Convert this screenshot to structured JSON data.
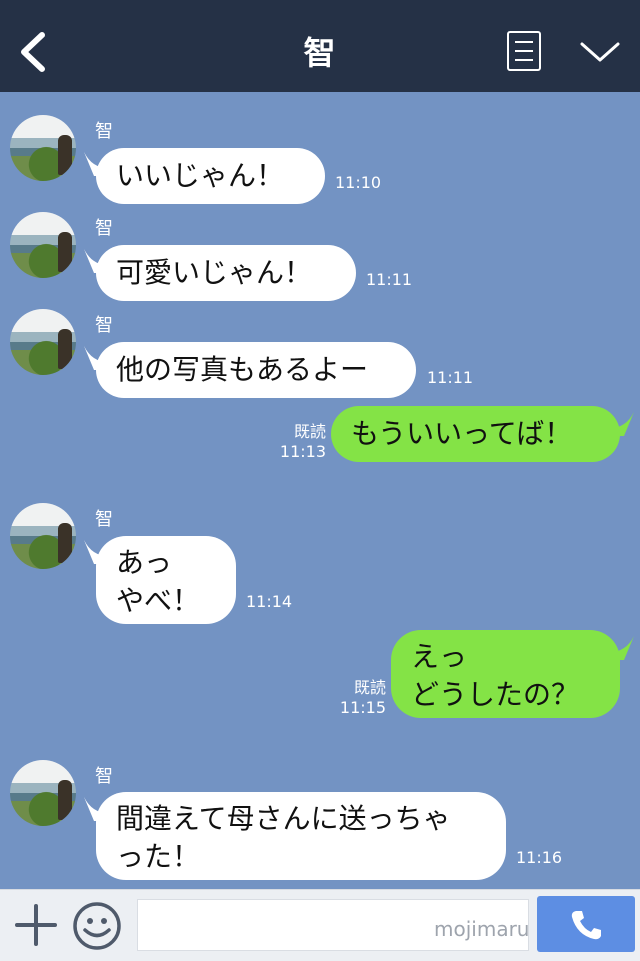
{
  "header": {
    "title": "智"
  },
  "messages": [
    {
      "id": 1,
      "side": "left",
      "sender": "智",
      "text": "いいじゃん！",
      "time": "11:10"
    },
    {
      "id": 2,
      "side": "left",
      "sender": "智",
      "text": "可愛いじゃん！",
      "time": "11:11"
    },
    {
      "id": 3,
      "side": "left",
      "sender": "智",
      "text": "他の写真もあるよー",
      "time": "11:11"
    },
    {
      "id": 4,
      "side": "right",
      "read": "既読",
      "text": "もういいってば！",
      "time": "11:13"
    },
    {
      "id": 5,
      "side": "left",
      "sender": "智",
      "text": "あっ\nやべ！",
      "time": "11:14"
    },
    {
      "id": 6,
      "side": "right",
      "read": "既読",
      "text": "えっ\nどうしたの？",
      "time": "11:15"
    },
    {
      "id": 7,
      "side": "left",
      "sender": "智",
      "text": "間違えて母さんに送っちゃ\nった！",
      "time": "11:16"
    }
  ],
  "footer": {
    "input_value": "",
    "watermark": "mojimaru"
  },
  "colors": {
    "header_bg": "#253146",
    "chat_bg": "#7393c3",
    "bubble_left": "#ffffff",
    "bubble_right": "#84e346",
    "call_button": "#5d8ee3"
  },
  "icons": {
    "back": "chevron-left-icon",
    "menu": "menu-list-icon",
    "collapse": "chevron-down-icon",
    "add": "plus-icon",
    "emoji": "smiley-icon",
    "call": "phone-icon"
  }
}
